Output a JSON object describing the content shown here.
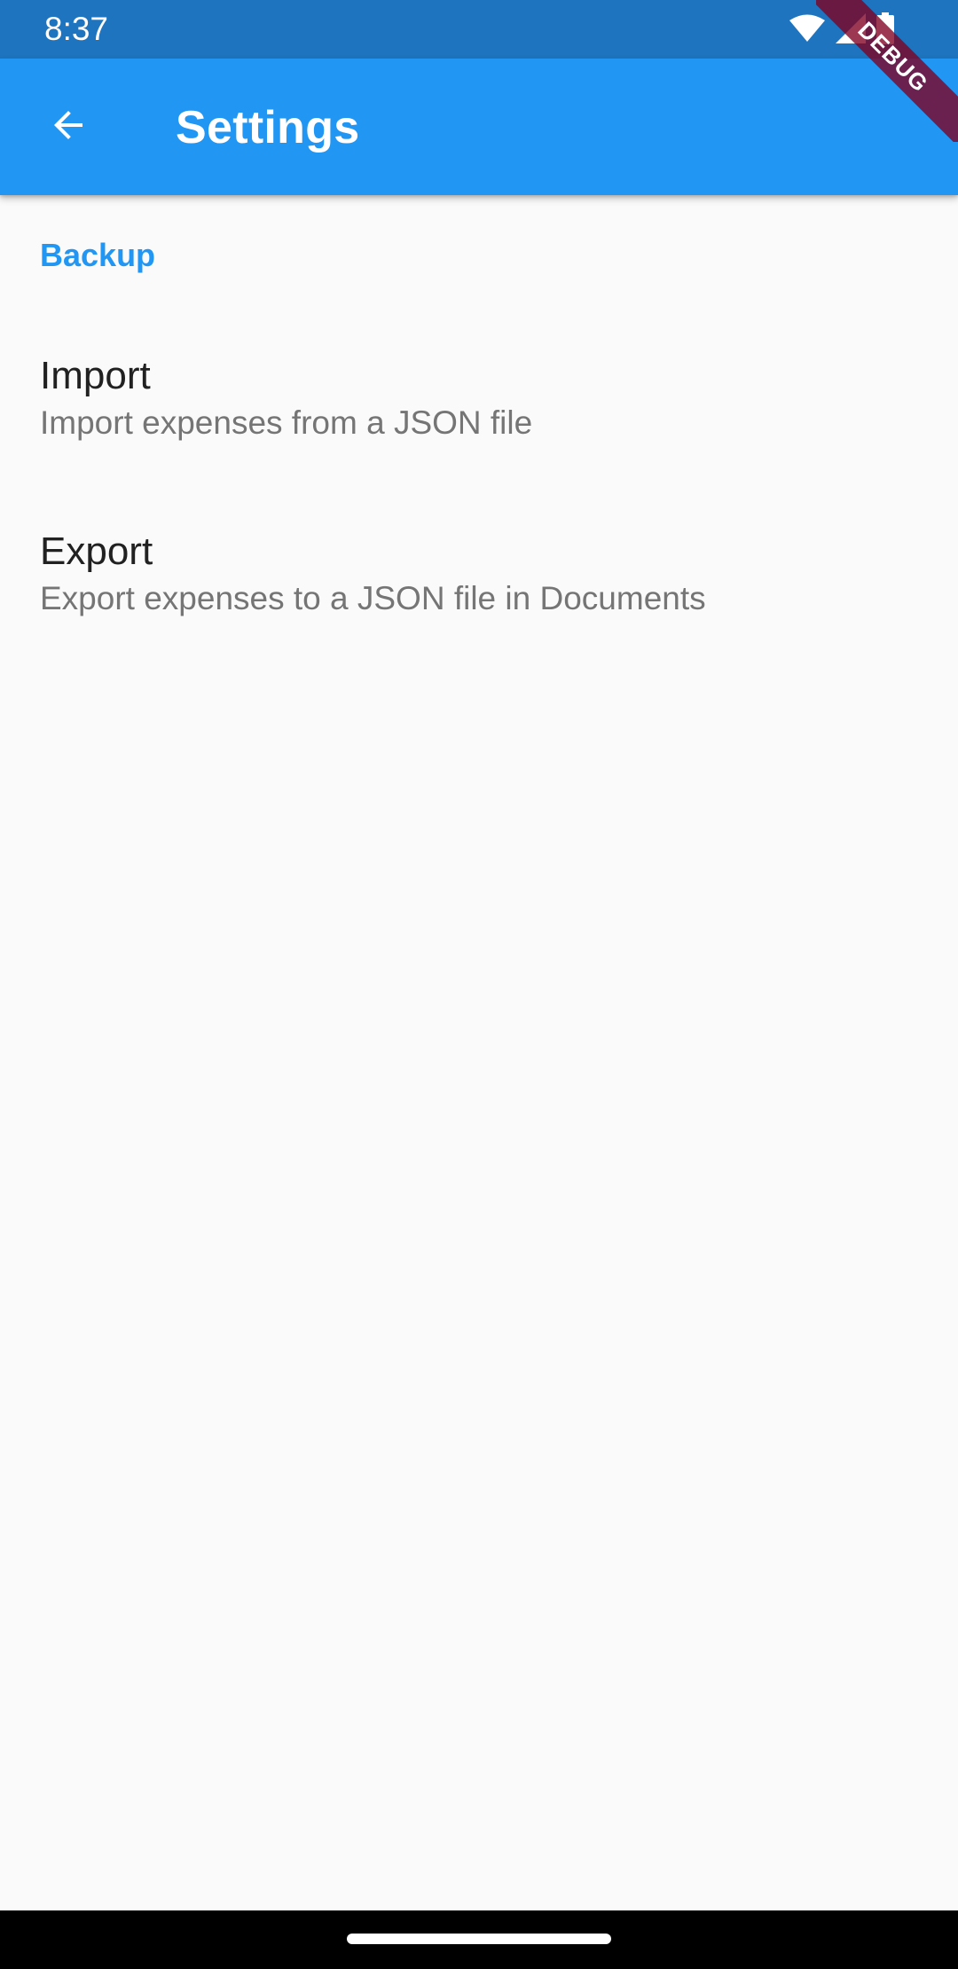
{
  "status_bar": {
    "time": "8:37",
    "icons": [
      "wifi-icon",
      "cellular-signal-icon",
      "battery-icon"
    ]
  },
  "app_bar": {
    "back_icon": "arrow-back-icon",
    "title": "Settings"
  },
  "debug_banner": {
    "label": "DEBUG"
  },
  "settings": {
    "section_header": "Backup",
    "items": [
      {
        "title": "Import",
        "subtitle": "Import expenses from a JSON file"
      },
      {
        "title": "Export",
        "subtitle": "Export expenses to a JSON file in Documents"
      }
    ]
  },
  "colors": {
    "status_bar": "#1E74BE",
    "app_bar": "#2196F3",
    "accent": "#2196F3",
    "background": "#FAFAFA",
    "title_text": "#212121",
    "subtitle_text": "#757575",
    "debug_banner": "#800020",
    "nav_bar": "#000000"
  }
}
